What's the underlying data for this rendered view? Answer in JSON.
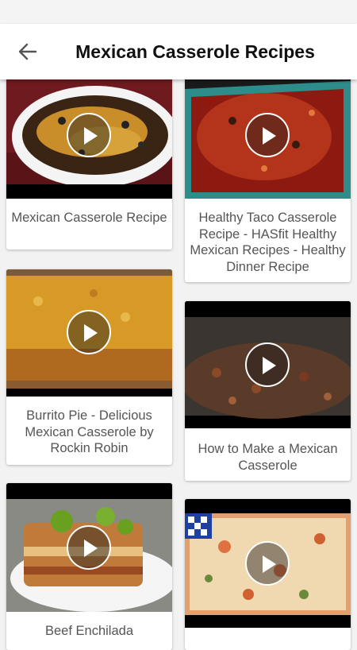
{
  "app": {
    "title": "Mexican Casserole Recipes"
  },
  "icons": {
    "back": "arrow-left-icon",
    "play": "play-icon"
  },
  "cards": [
    {
      "title": "Mexican Casserole Recipe"
    },
    {
      "title": "Healthy Taco Casserole Recipe - HASfit Healthy Mexican Recipes - Healthy Dinner Recipe"
    },
    {
      "title": "Burrito Pie - Delicious Mexican Casserole by Rockin Robin"
    },
    {
      "title": "How to Make a Mexican Casserole"
    },
    {
      "title": "Beef Enchilada"
    },
    {
      "title": ""
    }
  ]
}
